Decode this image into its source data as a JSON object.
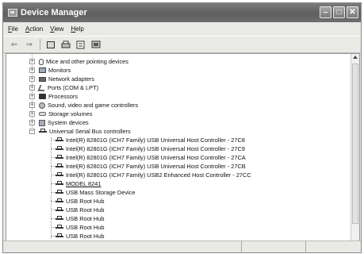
{
  "window": {
    "title": "Device Manager"
  },
  "menu": [
    "File",
    "Action",
    "View",
    "Help"
  ],
  "toolbar": {
    "back": "⇐",
    "forward": "⇒"
  },
  "tree": {
    "categories": [
      {
        "label": "Mice and other pointing devices",
        "icon": "mouse-icon"
      },
      {
        "label": "Monitors",
        "icon": "monitor-icon"
      },
      {
        "label": "Network adapters",
        "icon": "network-icon"
      },
      {
        "label": "Ports (COM & LPT)",
        "icon": "port-icon"
      },
      {
        "label": "Processors",
        "icon": "cpu-icon"
      },
      {
        "label": "Sound, video and game controllers",
        "icon": "sound-icon"
      },
      {
        "label": "Storage volumes",
        "icon": "storage-icon"
      },
      {
        "label": "System devices",
        "icon": "system-icon"
      },
      {
        "label": "Universal Serial Bus controllers",
        "icon": "usb-icon"
      }
    ],
    "usb_devices": [
      "Intel(R) 82801G (ICH7 Family) USB Universal Host Controller - 27C8",
      "Intel(R) 82801G (ICH7 Family) USB Universal Host Controller - 27C9",
      "Intel(R) 82801G (ICH7 Family) USB Universal Host Controller - 27CA",
      "Intel(R) 82801G (ICH7 Family) USB Universal Host Controller - 27CB",
      "Intel(R) 82801G (ICH7 Family) USB2 Enhanced Host Controller - 27CC",
      "MODEL 8241",
      "USB Mass Storage Device",
      "USB Root Hub",
      "USB Root Hub",
      "USB Root Hub",
      "USB Root Hub",
      "USB Root Hub"
    ]
  }
}
